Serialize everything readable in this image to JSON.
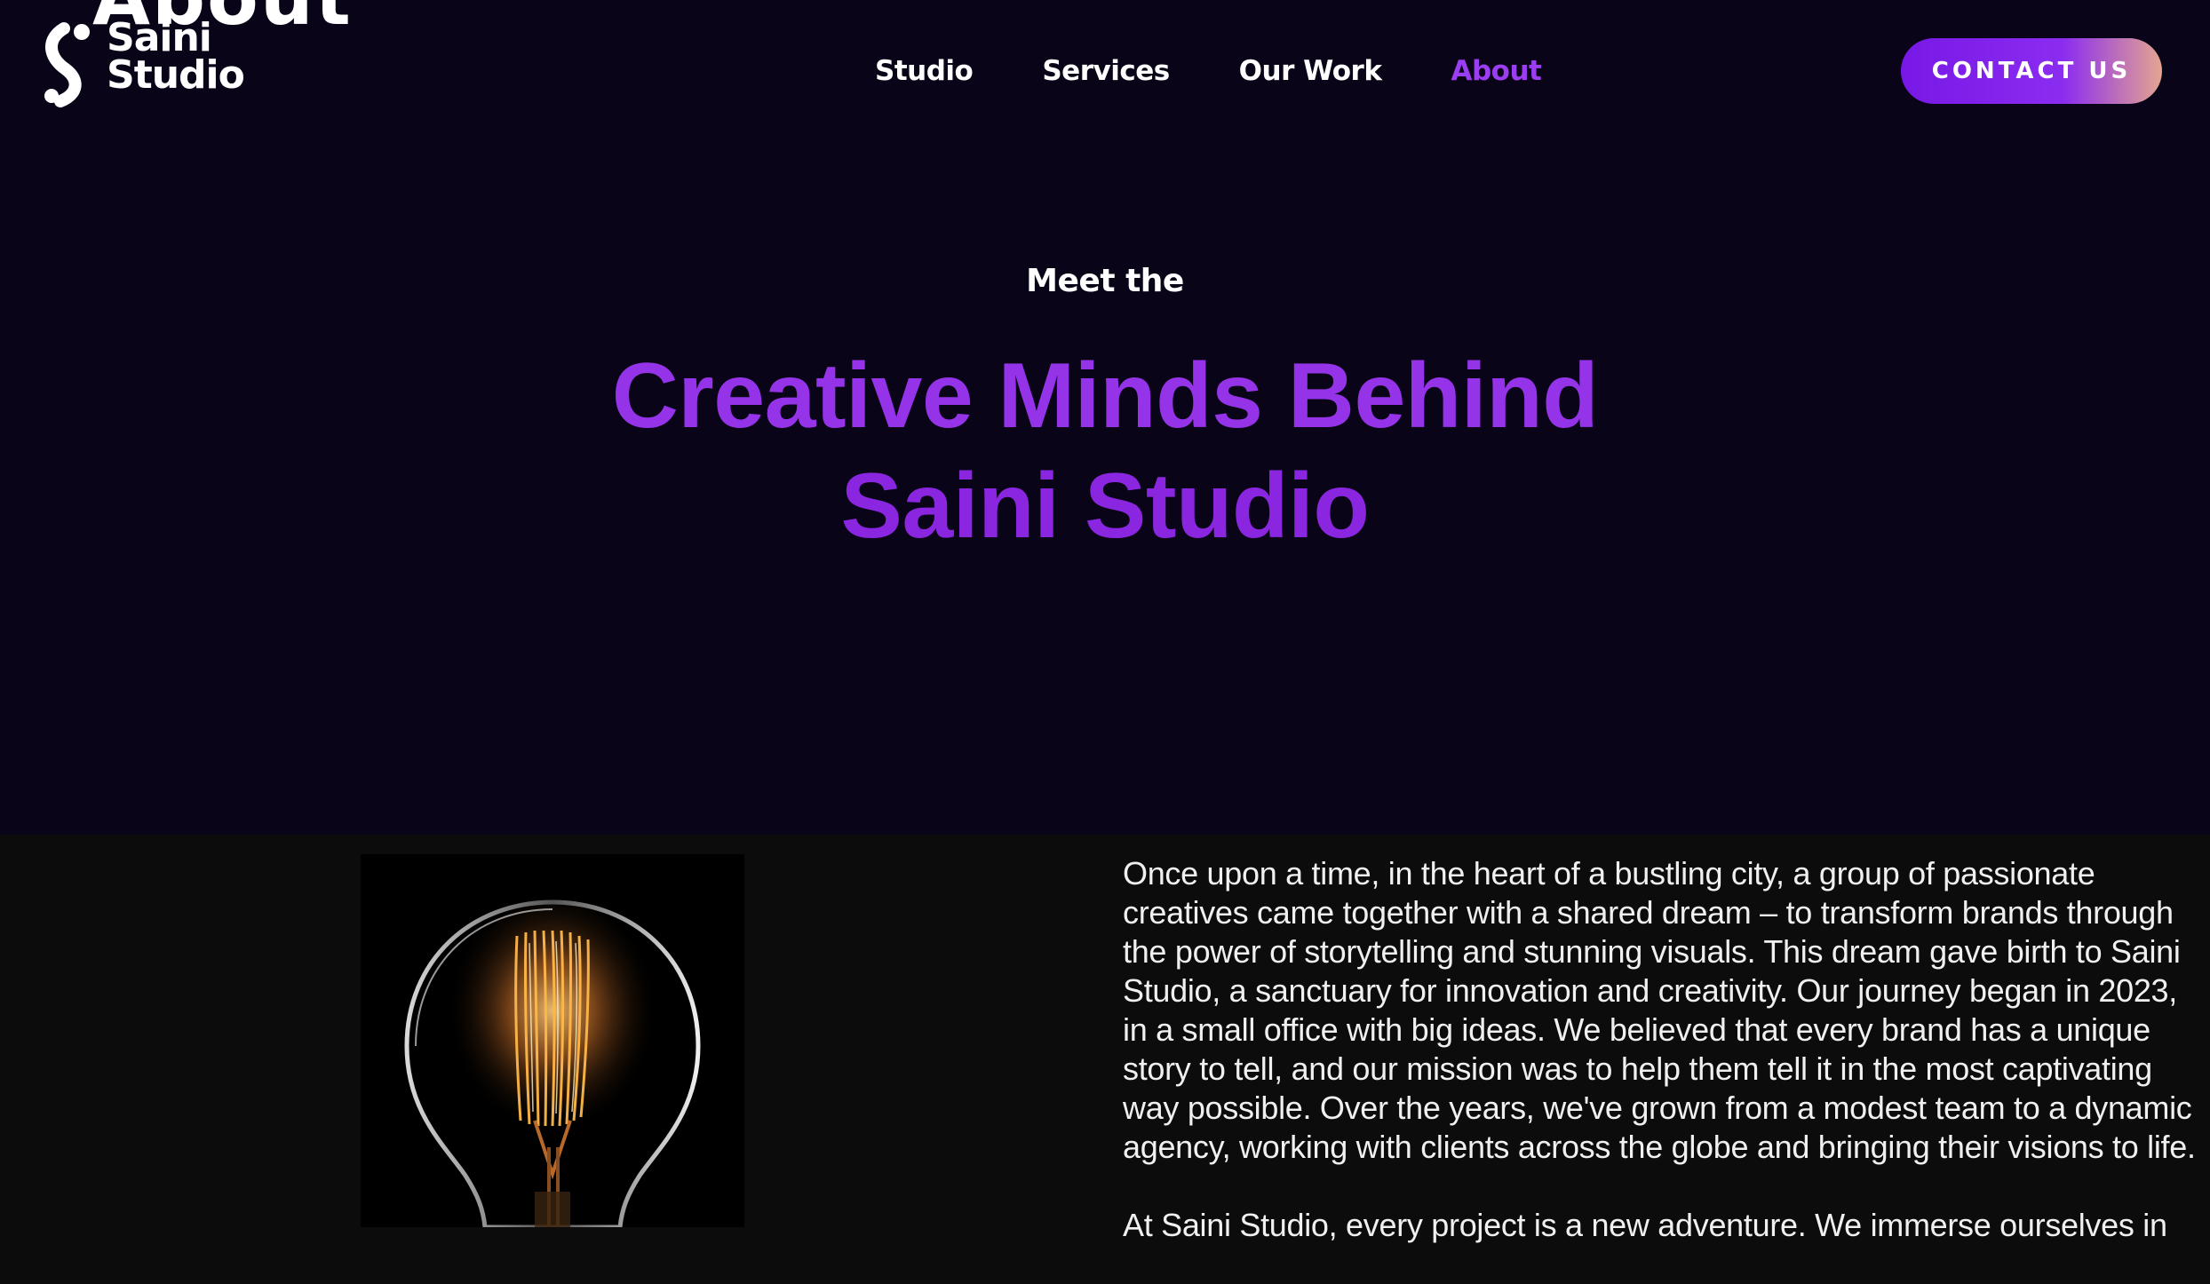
{
  "header": {
    "page_watermark": "About",
    "logo": {
      "line1": "Saini",
      "line2": "Studio"
    },
    "nav": [
      {
        "label": "Studio",
        "active": false
      },
      {
        "label": "Services",
        "active": false
      },
      {
        "label": "Our Work",
        "active": false
      },
      {
        "label": "About",
        "active": true
      }
    ],
    "cta_label": "CONTACT US"
  },
  "hero": {
    "eyebrow": "Meet the",
    "headline_line1": "Creative Minds Behind",
    "headline_line2": "Saini Studio"
  },
  "story": {
    "image_icon": "light-bulb-image",
    "paragraphs": [
      "Once upon a time, in the heart of a bustling city, a group of passionate creatives came together with a shared dream – to transform brands through the power of storytelling and stunning visuals. This dream gave birth to Saini Studio, a sanctuary for innovation and creativity. Our journey began in 2023, in a small office with big ideas. We believed that every brand has a unique story to tell, and our mission was to help them tell it in the most captivating way possible. Over the years, we've grown from a modest team to a dynamic agency, working with clients across the globe and bringing their visions to life.",
      "At Saini Studio, every project is a new adventure. We immerse ourselves in"
    ]
  },
  "colors": {
    "hero_background": "#0a0418",
    "page_background": "#0d0c0d",
    "accent_purple": "#9533e8",
    "cta_gradient_start": "#7818e6",
    "cta_gradient_end": "#e4a58f"
  }
}
